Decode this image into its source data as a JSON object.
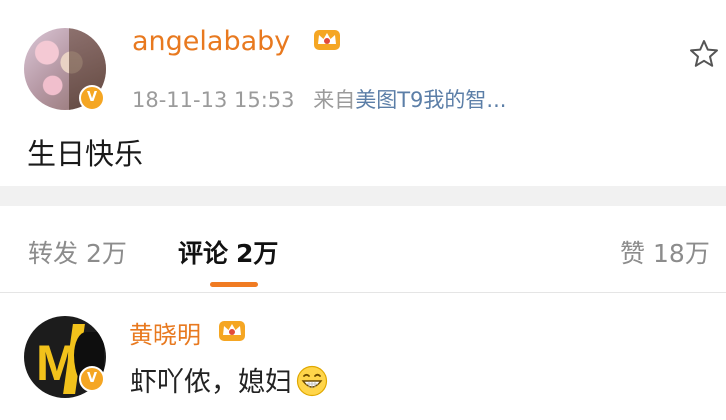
{
  "post": {
    "author": {
      "name": "angelababy",
      "avatar_icon": "avatar-photo",
      "verified_icon": "verified-v-icon",
      "member_icon": "crown-icon"
    },
    "timestamp": "18-11-13 15:53",
    "source_prefix": "来自",
    "source": "美图T9我的智...",
    "text": "生日快乐",
    "favorite_icon": "star-outline-icon"
  },
  "tabs": {
    "repost": {
      "label": "转发",
      "count": "2万"
    },
    "comments": {
      "label": "评论",
      "count": "2万",
      "active": true
    },
    "likes": {
      "label": "赞",
      "count": "18万"
    }
  },
  "comments": [
    {
      "author": "黄晓明",
      "text": "虾吖侬，媳妇",
      "emoji_icon": "grin-emoji-icon",
      "verified_icon": "verified-v-icon",
      "member_icon": "crown-icon"
    }
  ],
  "colors": {
    "accent": "#e8791f",
    "link": "#5b7ea7",
    "muted": "#9b9b9b",
    "verified": "#f5a623"
  }
}
